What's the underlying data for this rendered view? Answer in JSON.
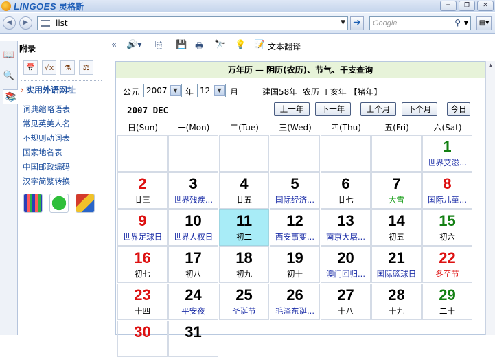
{
  "app": {
    "logo_text": "LINGOES",
    "logo_cn": "灵格斯"
  },
  "window_buttons": [
    "─",
    "❐",
    "✕"
  ],
  "address": {
    "value": "list"
  },
  "search": {
    "placeholder": "Google"
  },
  "sidebar": {
    "header": "附录",
    "section_title": "实用外语网址",
    "links": [
      "词典缩略语表",
      "常见英美人名",
      "不规则动词表",
      "国家地名表",
      "中国邮政编码",
      "汉字简繁转换"
    ]
  },
  "toolbar": {
    "translate_label": "文本翻译"
  },
  "calendar": {
    "title": "万年历 — 阴历(农历)、节气、干支查询",
    "era_label": "公元",
    "year_value": "2007",
    "year_suffix": "年",
    "month_value": "12",
    "month_suffix": "月",
    "lunar_info": "建国58年  农历 丁亥年 【猪年】",
    "month_header": "2007 DEC",
    "nav": {
      "prev_year": "上一年",
      "next_year": "下一年",
      "prev_month": "上个月",
      "next_month": "下个月",
      "today": "今日"
    },
    "weekdays": [
      "日(Sun)",
      "一(Mon)",
      "二(Tue)",
      "三(Wed)",
      "四(Thu)",
      "五(Fri)",
      "六(Sat)"
    ],
    "days": [
      {
        "day": "1",
        "sub": "世界艾滋...",
        "color": "green",
        "sub_color": "blue",
        "col": 6,
        "row": 0
      },
      {
        "day": "2",
        "sub": "廿三",
        "color": "red",
        "sub_color": "black",
        "col": 0,
        "row": 1
      },
      {
        "day": "3",
        "sub": "世界残疾...",
        "color": "black",
        "sub_color": "blue",
        "col": 1,
        "row": 1
      },
      {
        "day": "4",
        "sub": "廿五",
        "color": "black",
        "sub_color": "black",
        "col": 2,
        "row": 1
      },
      {
        "day": "5",
        "sub": "国际经济...",
        "color": "black",
        "sub_color": "blue",
        "col": 3,
        "row": 1
      },
      {
        "day": "6",
        "sub": "廿七",
        "color": "black",
        "sub_color": "black",
        "col": 4,
        "row": 1
      },
      {
        "day": "7",
        "sub": "大雪",
        "color": "black",
        "sub_color": "green",
        "col": 5,
        "row": 1
      },
      {
        "day": "8",
        "sub": "国际儿童...",
        "color": "red",
        "sub_color": "blue",
        "col": 6,
        "row": 1
      },
      {
        "day": "9",
        "sub": "世界足球日",
        "color": "red",
        "sub_color": "blue",
        "col": 0,
        "row": 2
      },
      {
        "day": "10",
        "sub": "世界人权日",
        "color": "black",
        "sub_color": "blue",
        "col": 1,
        "row": 2
      },
      {
        "day": "11",
        "sub": "初二",
        "color": "black",
        "sub_color": "black",
        "col": 2,
        "row": 2,
        "today": true
      },
      {
        "day": "12",
        "sub": "西安事变...",
        "color": "black",
        "sub_color": "blue",
        "col": 3,
        "row": 2
      },
      {
        "day": "13",
        "sub": "南京大屠...",
        "color": "black",
        "sub_color": "blue",
        "col": 4,
        "row": 2
      },
      {
        "day": "14",
        "sub": "初五",
        "color": "black",
        "sub_color": "black",
        "col": 5,
        "row": 2
      },
      {
        "day": "15",
        "sub": "初六",
        "color": "green",
        "sub_color": "black",
        "col": 6,
        "row": 2
      },
      {
        "day": "16",
        "sub": "初七",
        "color": "red",
        "sub_color": "black",
        "col": 0,
        "row": 3
      },
      {
        "day": "17",
        "sub": "初八",
        "color": "black",
        "sub_color": "black",
        "col": 1,
        "row": 3
      },
      {
        "day": "18",
        "sub": "初九",
        "color": "black",
        "sub_color": "black",
        "col": 2,
        "row": 3
      },
      {
        "day": "19",
        "sub": "初十",
        "color": "black",
        "sub_color": "black",
        "col": 3,
        "row": 3
      },
      {
        "day": "20",
        "sub": "澳门回归...",
        "color": "black",
        "sub_color": "blue",
        "col": 4,
        "row": 3
      },
      {
        "day": "21",
        "sub": "国际篮球日",
        "color": "black",
        "sub_color": "blue",
        "col": 5,
        "row": 3
      },
      {
        "day": "22",
        "sub": "冬至节",
        "color": "red",
        "sub_color": "red",
        "col": 6,
        "row": 3
      },
      {
        "day": "23",
        "sub": "十四",
        "color": "red",
        "sub_color": "black",
        "col": 0,
        "row": 4
      },
      {
        "day": "24",
        "sub": "平安夜",
        "color": "black",
        "sub_color": "blue",
        "col": 1,
        "row": 4
      },
      {
        "day": "25",
        "sub": "圣诞节",
        "color": "black",
        "sub_color": "blue",
        "col": 2,
        "row": 4
      },
      {
        "day": "26",
        "sub": "毛泽东诞...",
        "color": "black",
        "sub_color": "blue",
        "col": 3,
        "row": 4
      },
      {
        "day": "27",
        "sub": "十八",
        "color": "black",
        "sub_color": "black",
        "col": 4,
        "row": 4
      },
      {
        "day": "28",
        "sub": "十九",
        "color": "black",
        "sub_color": "black",
        "col": 5,
        "row": 4
      },
      {
        "day": "29",
        "sub": "二十",
        "color": "green",
        "sub_color": "black",
        "col": 6,
        "row": 4
      },
      {
        "day": "30",
        "sub": "",
        "color": "red",
        "sub_color": "black",
        "col": 0,
        "row": 5
      },
      {
        "day": "31",
        "sub": "",
        "color": "black",
        "sub_color": "black",
        "col": 1,
        "row": 5
      }
    ]
  },
  "colors": {
    "accent": "#1d4f9e",
    "today_bg": "#a8ecf7",
    "title_bg": "#e7f3d9"
  }
}
